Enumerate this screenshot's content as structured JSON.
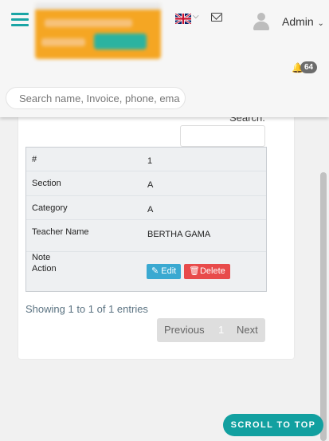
{
  "header": {
    "user_name": "Admin",
    "notification_count": "64",
    "search_placeholder": "Search name, Invoice, phone, ema"
  },
  "table": {
    "search_label": "Search:",
    "rows": [
      {
        "key": "#",
        "value": "1"
      },
      {
        "key": "Section",
        "value": "A"
      },
      {
        "key": "Category",
        "value": "A"
      },
      {
        "key": "Teacher Name",
        "value": "BERTHA GAMA"
      },
      {
        "key": "Note",
        "value": ""
      },
      {
        "key": "Action",
        "value": ""
      }
    ],
    "edit_label": "Edit",
    "delete_label": "Delete"
  },
  "pagination": {
    "info": "Showing 1 to 1 of 1 entries",
    "previous": "Previous",
    "current": "1",
    "next": "Next"
  },
  "scroll_top_label": "SCROLL TO TOP",
  "colors": {
    "accent": "#12a0a0",
    "edit": "#3aa9d1",
    "delete": "#e84b4b"
  }
}
